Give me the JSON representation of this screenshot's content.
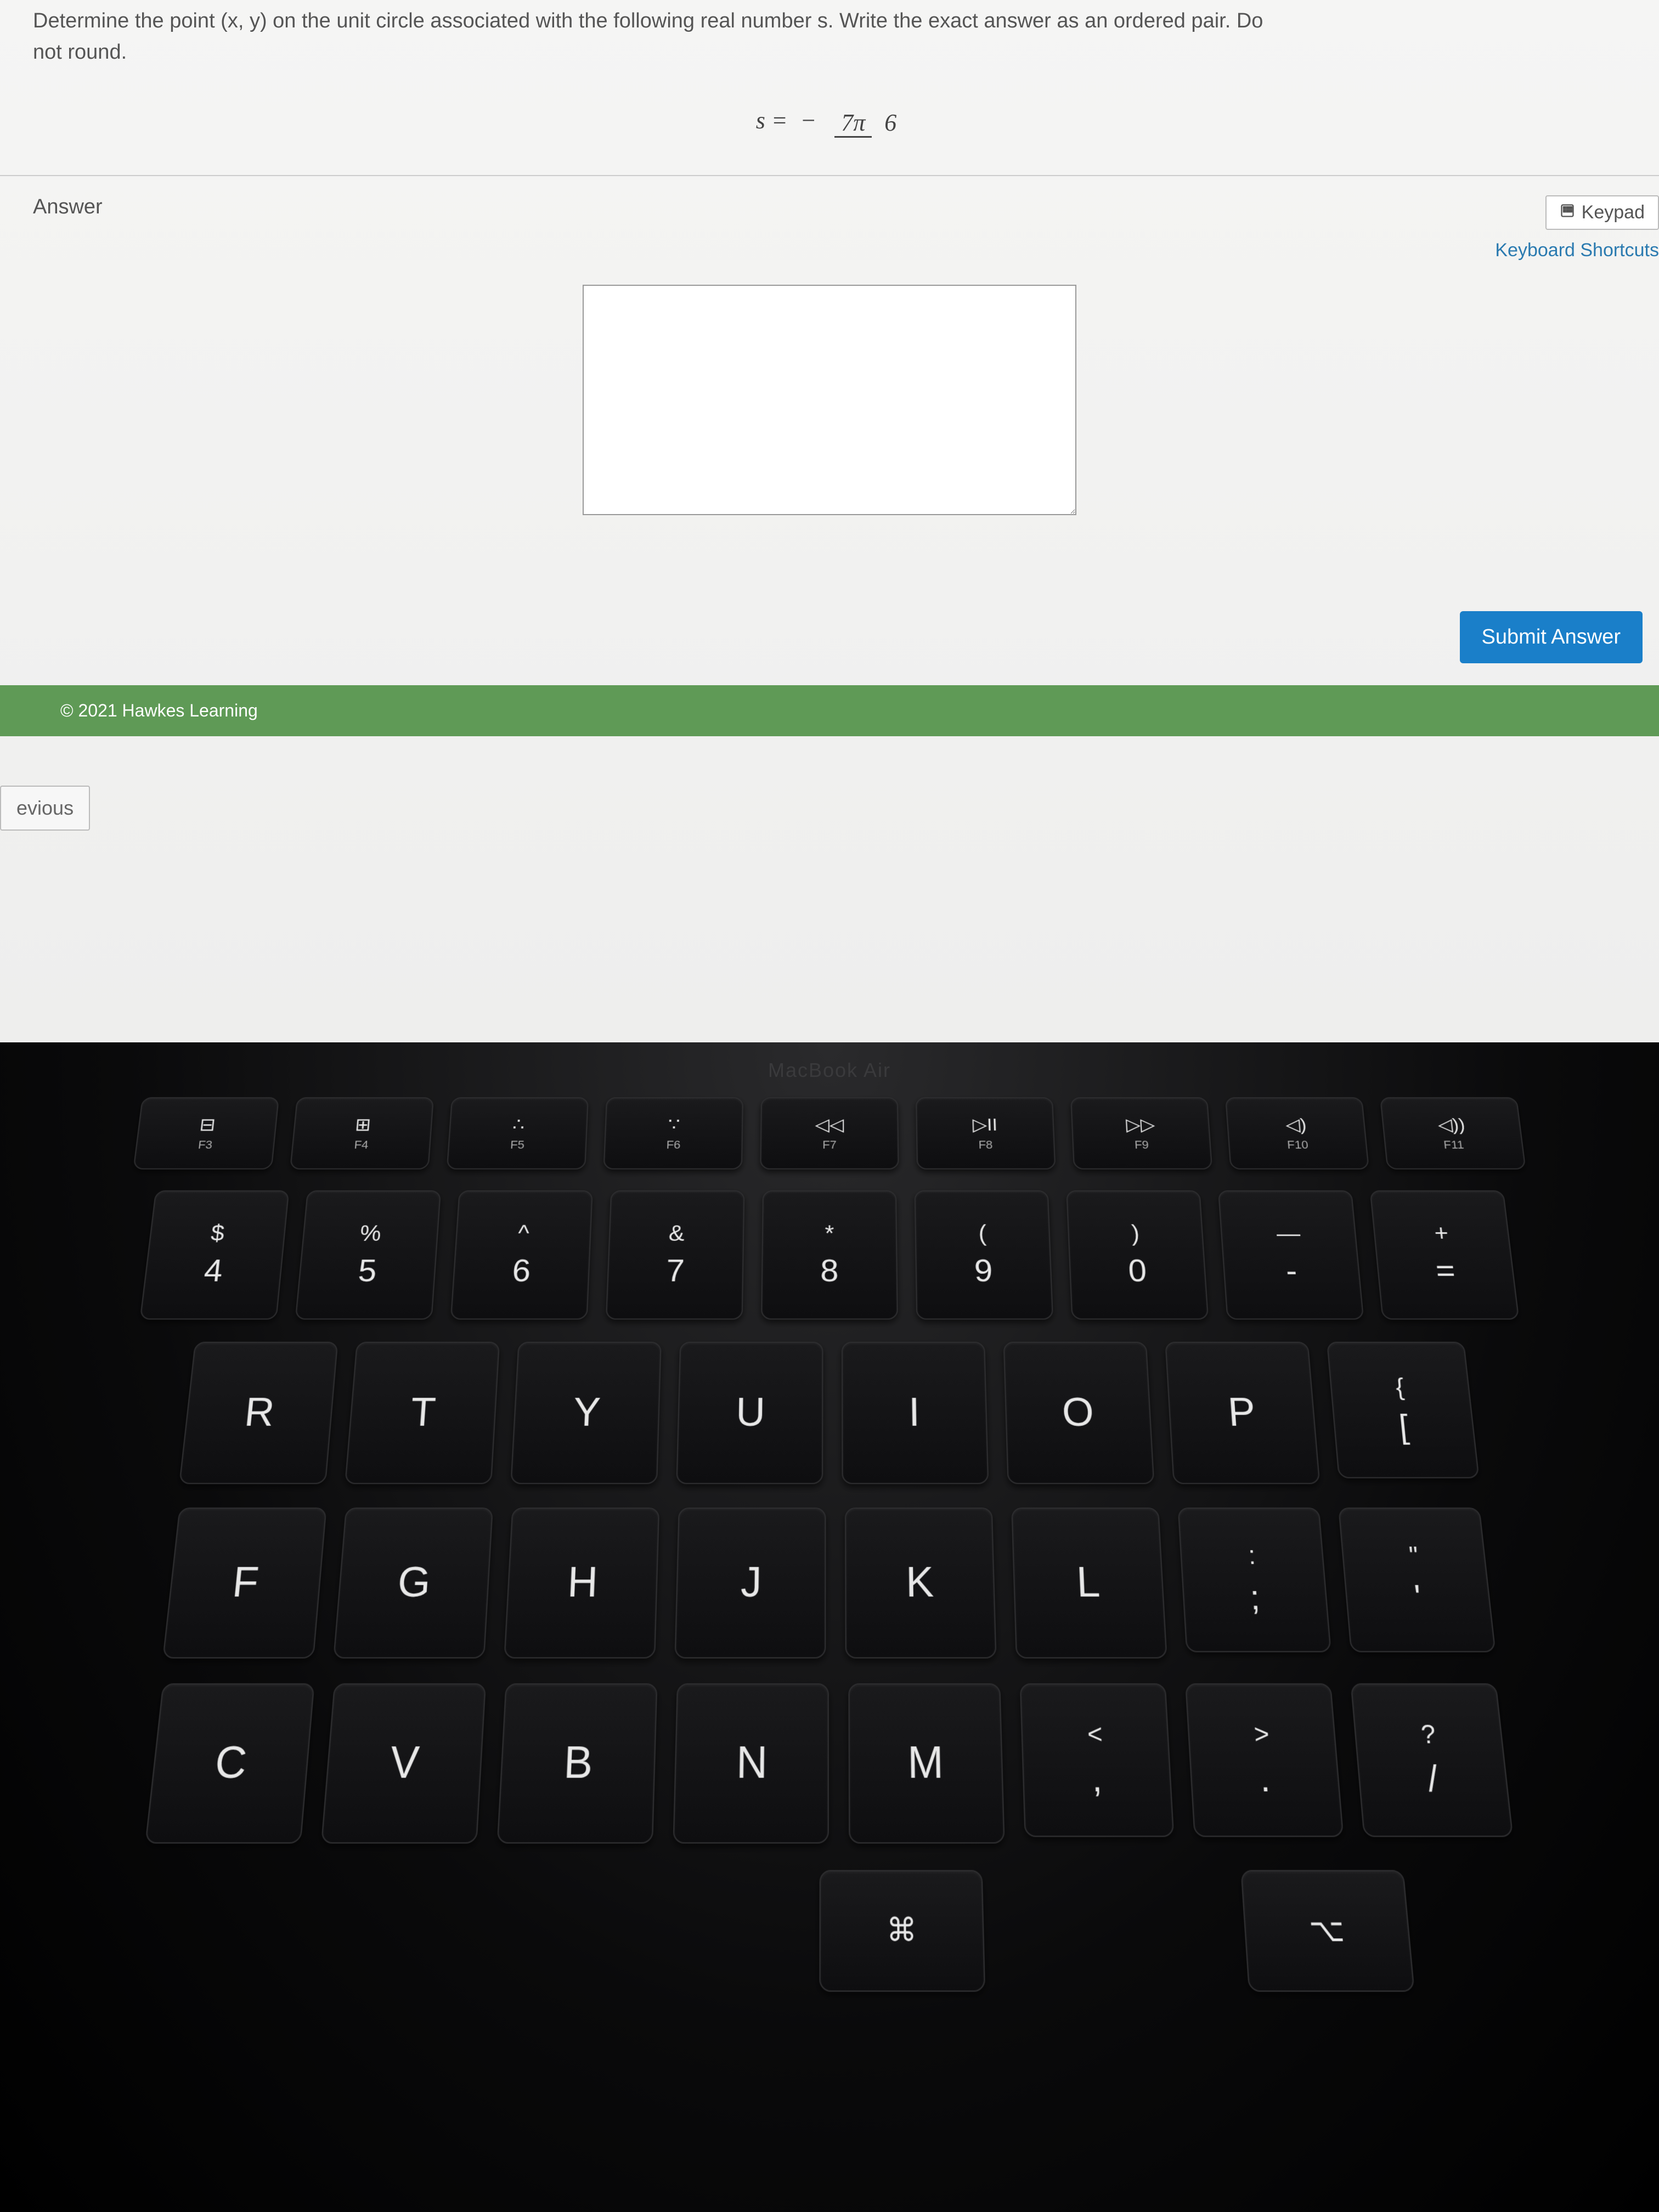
{
  "question": {
    "prompt_line1": "Determine the point (x, y) on the unit circle associated with the following real number s. Write the exact answer as an ordered pair. Do",
    "prompt_line2": "not round.",
    "equation_lhs": "s =",
    "equation_sign": "−",
    "equation_num": "7π",
    "equation_den": "6"
  },
  "answer_section": {
    "label": "Answer",
    "keypad_label": "Keypad",
    "shortcuts_label": "Keyboard Shortcuts",
    "input_value": ""
  },
  "submit_label": "Submit Answer",
  "copyright": "© 2021 Hawkes Learning",
  "nav": {
    "previous": "evious"
  },
  "laptop_label": "MacBook Air",
  "keyboard": {
    "frow": [
      {
        "icon": "⊟",
        "label": "F3",
        "name": "f3"
      },
      {
        "icon": "⊞",
        "label": "F4",
        "name": "f4"
      },
      {
        "icon": "∴",
        "label": "F5",
        "name": "f5"
      },
      {
        "icon": "∵",
        "label": "F6",
        "name": "f6"
      },
      {
        "icon": "◁◁",
        "label": "F7",
        "name": "f7"
      },
      {
        "icon": "▷II",
        "label": "F8",
        "name": "f8"
      },
      {
        "icon": "▷▷",
        "label": "F9",
        "name": "f9"
      },
      {
        "icon": "◁)",
        "label": "F10",
        "name": "f10"
      },
      {
        "icon": "◁))",
        "label": "F11",
        "name": "f11"
      }
    ],
    "numrow": [
      {
        "top": "$",
        "bot": "4"
      },
      {
        "top": "%",
        "bot": "5"
      },
      {
        "top": "^",
        "bot": "6"
      },
      {
        "top": "&",
        "bot": "7"
      },
      {
        "top": "*",
        "bot": "8"
      },
      {
        "top": "(",
        "bot": "9"
      },
      {
        "top": ")",
        "bot": "0"
      },
      {
        "top": "—",
        "bot": "-"
      },
      {
        "top": "+",
        "bot": "="
      }
    ],
    "row_q": [
      "R",
      "T",
      "Y",
      "U",
      "I",
      "O",
      "P"
    ],
    "row_q_end": {
      "top": "{",
      "bot": "["
    },
    "row_a": [
      "F",
      "G",
      "H",
      "J",
      "K",
      "L"
    ],
    "row_a_end1": {
      "top": ":",
      "bot": ";"
    },
    "row_a_end2": {
      "top": "\"",
      "bot": "'"
    },
    "row_z": [
      "C",
      "V",
      "B",
      "N",
      "M"
    ],
    "row_z_end1": {
      "top": "<",
      "bot": ","
    },
    "row_z_end2": {
      "top": ">",
      "bot": "."
    },
    "row_z_end3": {
      "top": "?",
      "bot": "/"
    },
    "cmd_sym": "⌘",
    "opt_sym": "⌥"
  }
}
